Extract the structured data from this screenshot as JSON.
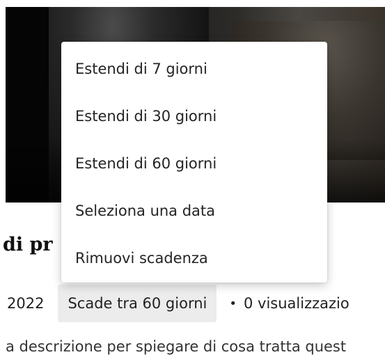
{
  "video": {
    "title_partial": "di pr",
    "date_partial": "2022",
    "expiration_label": "Scade tra 60 giorni",
    "separator": "•",
    "views_partial": "0 visualizzazio",
    "description_partial": "a descrizione per spiegare di cosa tratta quest"
  },
  "expiration_menu": {
    "items": [
      {
        "label": "Estendi di 7 giorni"
      },
      {
        "label": "Estendi di 30 giorni"
      },
      {
        "label": "Estendi di 60 giorni"
      },
      {
        "label": "Seleziona una data"
      },
      {
        "label": "Rimuovi scadenza"
      }
    ]
  }
}
